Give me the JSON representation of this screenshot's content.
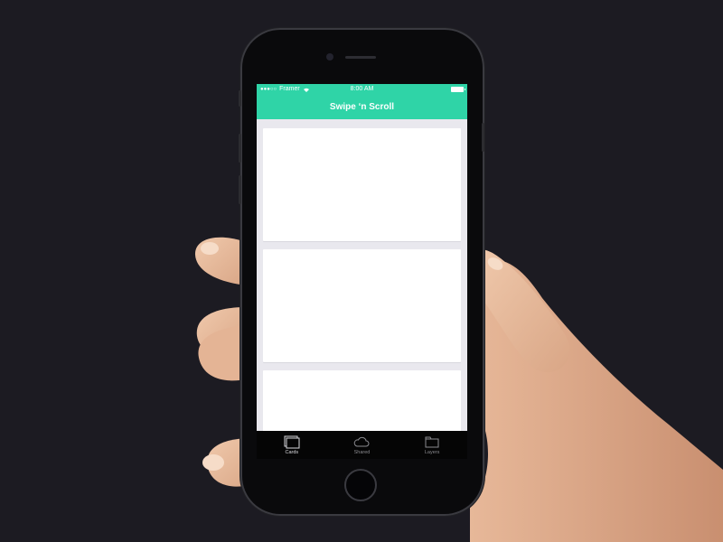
{
  "status_bar": {
    "signal": "●●●○○",
    "carrier": "Framer",
    "wifi_icon": "wifi-icon",
    "time": "8:00 AM",
    "battery_icon": "battery-icon"
  },
  "nav": {
    "title": "Swipe ‘n Scroll"
  },
  "cards": [
    {
      "id": "card-1"
    },
    {
      "id": "card-2"
    },
    {
      "id": "card-3"
    }
  ],
  "tab_bar": {
    "tabs": [
      {
        "label": "Cards",
        "icon": "cards-icon",
        "active": true
      },
      {
        "label": "Shared",
        "icon": "cloud-icon",
        "active": false
      },
      {
        "label": "Layers",
        "icon": "layers-icon",
        "active": false
      }
    ]
  },
  "colors": {
    "background": "#1c1b22",
    "accent": "#2fd4a7",
    "card": "#ffffff",
    "tab_bar": "#050505"
  }
}
